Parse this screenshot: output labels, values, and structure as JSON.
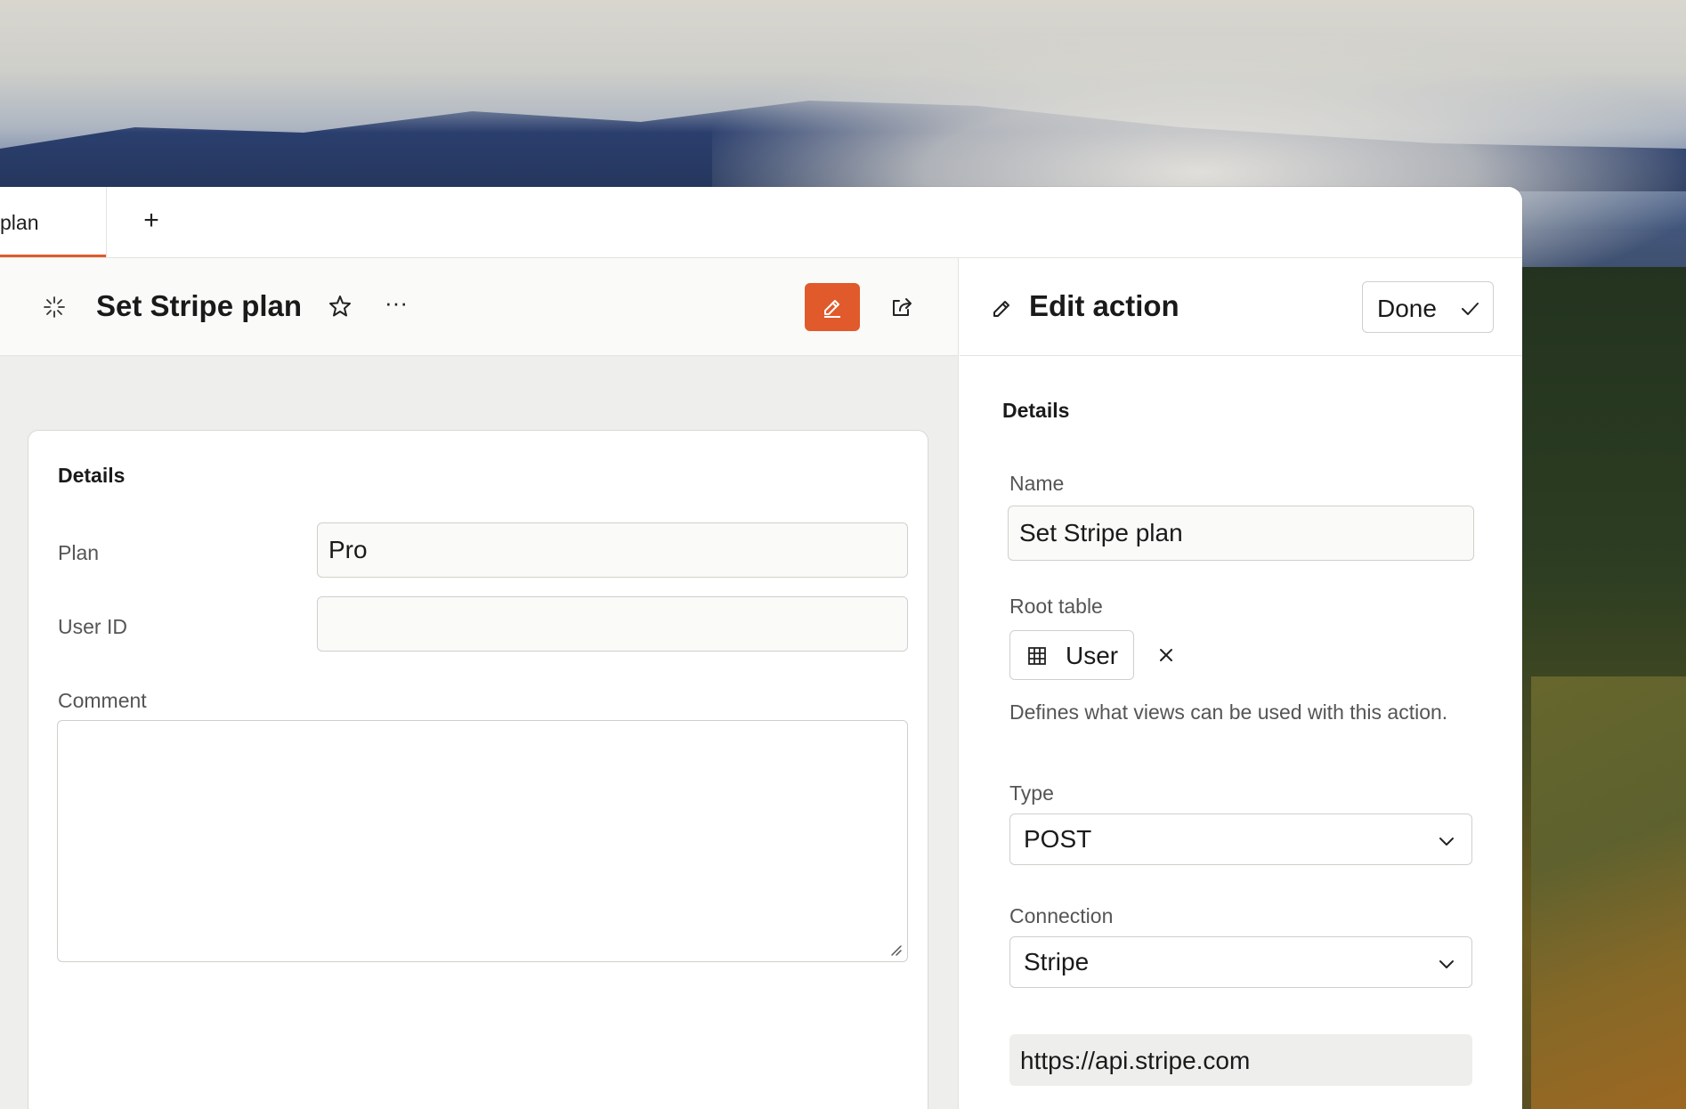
{
  "tabs": [
    {
      "label": "plan",
      "active": true
    }
  ],
  "tab_add_label": "+",
  "main": {
    "title": "Set Stripe plan",
    "more_label": "···",
    "accent_color": "#e05a2b",
    "card": {
      "title": "Details",
      "plan_label": "Plan",
      "plan_value": "Pro",
      "user_id_label": "User ID",
      "user_id_value": "",
      "comment_label": "Comment",
      "comment_value": ""
    }
  },
  "side_panel": {
    "title": "Edit action",
    "done_label": "Done",
    "section_title": "Details",
    "name_label": "Name",
    "name_value": "Set Stripe plan",
    "root_table_label": "Root table",
    "root_table_value": "User",
    "root_table_help": "Defines what views can be used with this action.",
    "type_label": "Type",
    "type_value": "POST",
    "connection_label": "Connection",
    "connection_value": "Stripe",
    "url_value": "https://api.stripe.com"
  },
  "icons": {
    "action": "sparkle-icon",
    "favorite": "star-icon",
    "edit": "pencil-icon",
    "share": "share-icon",
    "done": "check-icon",
    "table": "table-grid-icon",
    "remove": "close-icon",
    "dropdown": "chevron-down-icon"
  }
}
